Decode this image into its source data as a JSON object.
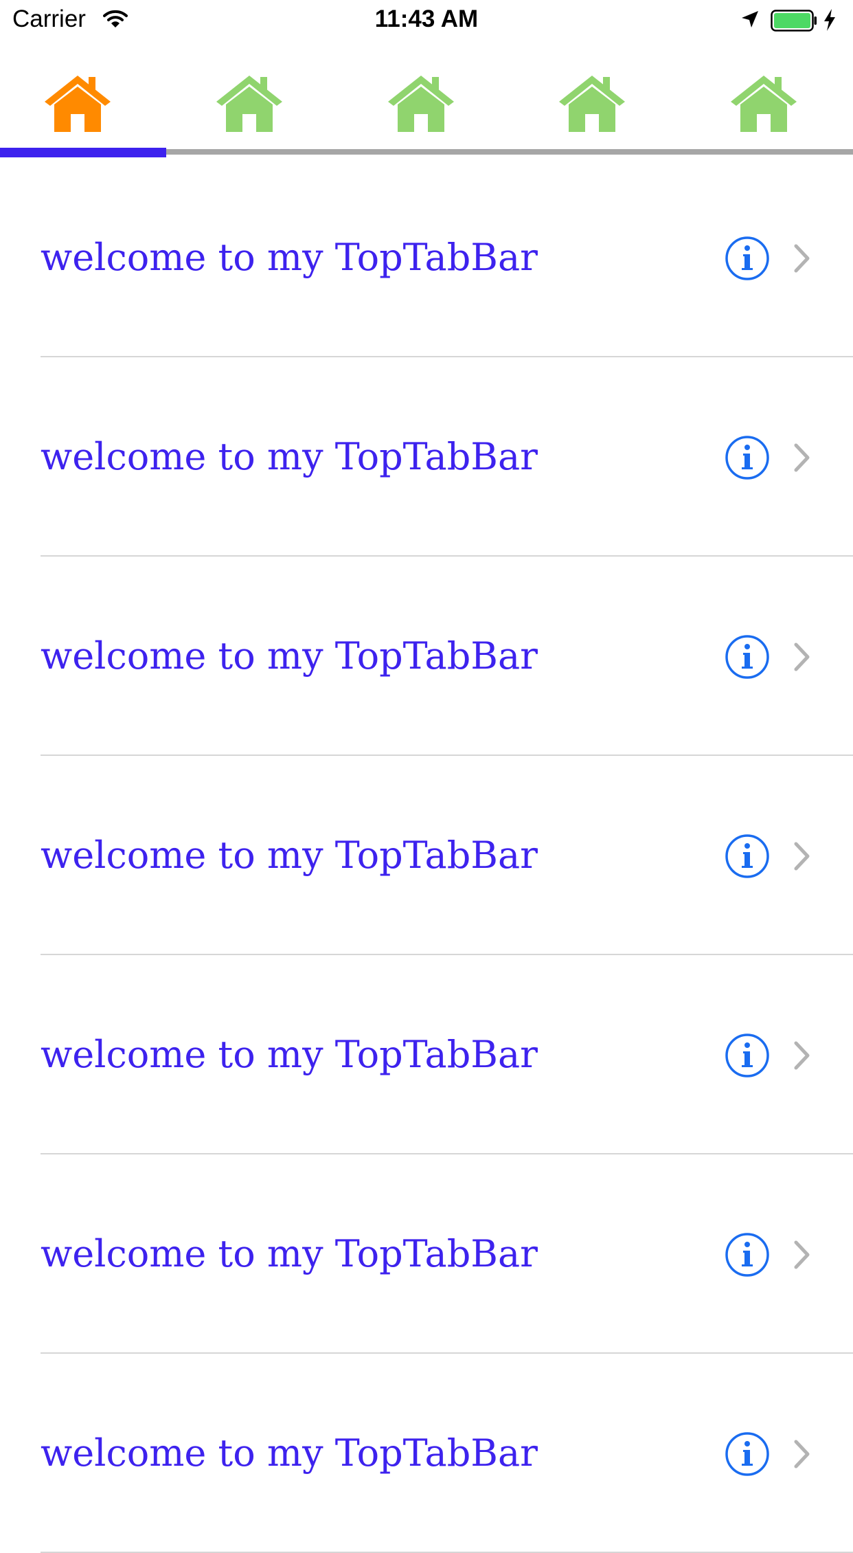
{
  "status_bar": {
    "carrier": "Carrier",
    "time": "11:43 AM",
    "battery_color": "#4cd964"
  },
  "tabs": [
    {
      "icon": "home-icon",
      "color": "#ff8a00",
      "selected": true
    },
    {
      "icon": "home-icon",
      "color": "#90d46e",
      "selected": false
    },
    {
      "icon": "home-icon",
      "color": "#90d46e",
      "selected": false
    },
    {
      "icon": "home-icon",
      "color": "#90d46e",
      "selected": false
    },
    {
      "icon": "home-icon",
      "color": "#90d46e",
      "selected": false
    }
  ],
  "colors": {
    "accent": "#3d22ee",
    "info": "#1a6cf0",
    "chevron": "#b3b3b3",
    "separator": "#d6d6d6",
    "tab_track": "#a6a6a6"
  },
  "list": {
    "items": [
      {
        "label": "welcome to my TopTabBar",
        "accessory": "info-icon"
      },
      {
        "label": "welcome to my TopTabBar",
        "accessory": "info-icon"
      },
      {
        "label": "welcome to my TopTabBar",
        "accessory": "info-icon"
      },
      {
        "label": "welcome to my TopTabBar",
        "accessory": "info-icon"
      },
      {
        "label": "welcome to my TopTabBar",
        "accessory": "info-icon"
      },
      {
        "label": "welcome to my TopTabBar",
        "accessory": "info-icon"
      },
      {
        "label": "welcome to my TopTabBar",
        "accessory": "info-icon"
      }
    ]
  }
}
